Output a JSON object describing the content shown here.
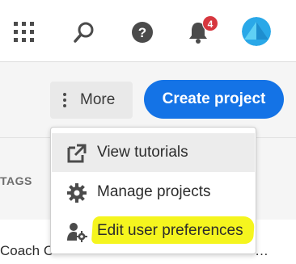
{
  "header": {
    "icons": {
      "apps": "grid-icon",
      "search": "search-icon",
      "help": "help-icon",
      "notifications": "bell-icon"
    },
    "notification_count": "4",
    "colors": {
      "badge": "#d7373f",
      "avatar_light": "#3ec5f0",
      "avatar_dark": "#1e8ecf"
    }
  },
  "toolbar": {
    "more_label": "More",
    "create_label": "Create project",
    "colors": {
      "create_button": "#1473e6"
    }
  },
  "table": {
    "columns": [
      "TAGS"
    ],
    "rows": [
      {
        "name": "Coach C",
        "trailing": "…"
      }
    ]
  },
  "menu": {
    "items": [
      {
        "label": "View tutorials",
        "icon": "external-link-icon",
        "hovered": true
      },
      {
        "label": "Manage projects",
        "icon": "gear-icon",
        "hovered": false
      },
      {
        "label": "Edit user preferences",
        "icon": "user-settings-icon",
        "highlighted": true
      }
    ],
    "colors": {
      "highlight": "#f5f51e"
    }
  }
}
